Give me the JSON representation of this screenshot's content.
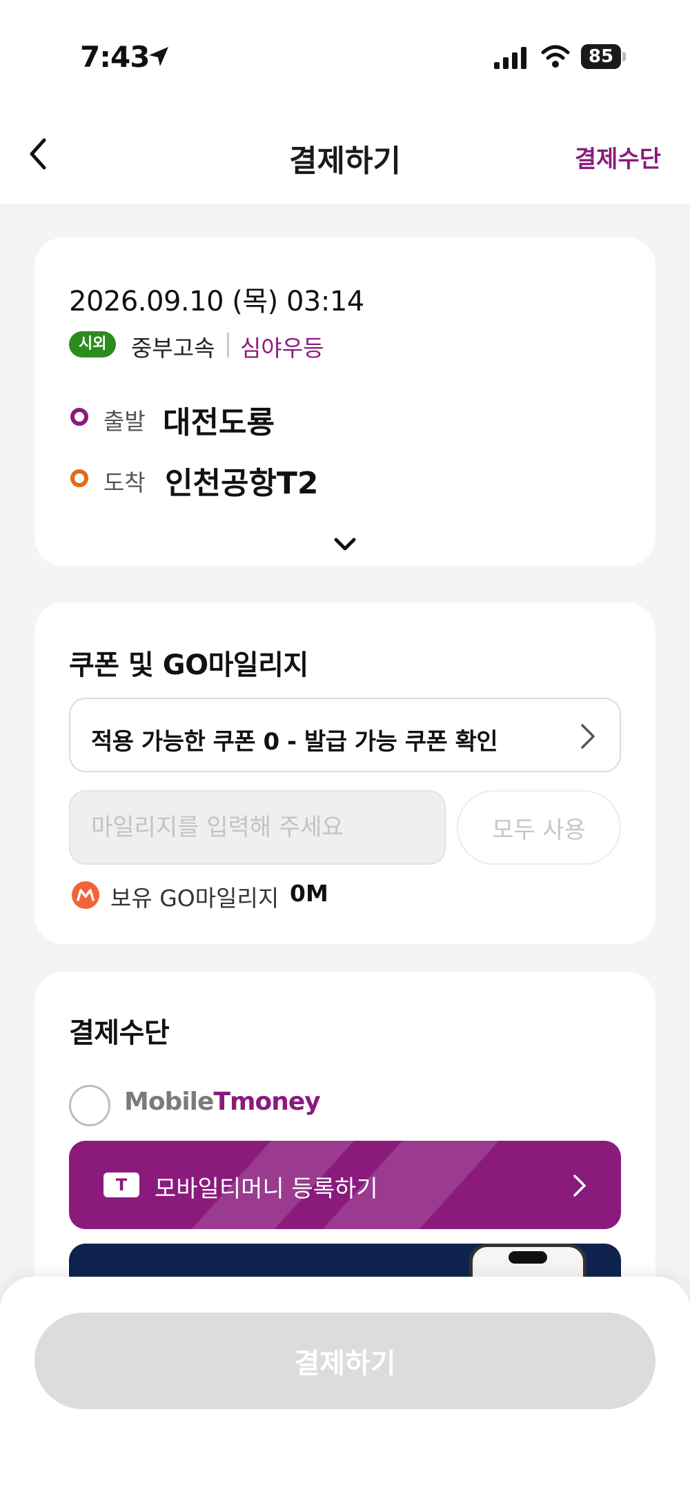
{
  "status_bar": {
    "time": "7:43",
    "battery": "85"
  },
  "header": {
    "title": "결제하기",
    "right_link": "결제수단"
  },
  "trip": {
    "datetime": "2026.09.10 (목) 03:14",
    "badge": "시외",
    "operator": "중부고속",
    "bus_class": "심야우등",
    "departure_label": "출발",
    "departure": "대전도룡",
    "arrival_label": "도착",
    "arrival": "인천공항T2"
  },
  "coupon": {
    "title": "쿠폰 및 GO마일리지",
    "coupon_row": "적용 가능한 쿠폰 0 - 발급 가능 쿠폰 확인",
    "mileage_placeholder": "마일리지를 입력해 주세요",
    "use_all": "모두 사용",
    "balance_label": "보유 GO마일리지",
    "balance_value": "0M"
  },
  "payment": {
    "title": "결제수단",
    "logo_prefix": "Mobile",
    "logo_suffix": "Tmoney",
    "register_icon": "T",
    "register_label": "모바일티머니 등록하기"
  },
  "footer": {
    "pay_button": "결제하기"
  },
  "colors": {
    "accent": "#8a1b7d",
    "badge": "#2e8b1e",
    "arrival_dot": "#e26a1b",
    "mileage_icon": "#f0643c",
    "promo_bg": "#0e244e",
    "disabled_button": "#dcdcdc"
  },
  "icons": [
    "location-arrow-icon",
    "signal-icon",
    "wifi-icon",
    "battery-icon",
    "back-icon",
    "chevron-down-icon",
    "chevron-right-icon",
    "mileage-icon",
    "tmoney-t-icon"
  ]
}
